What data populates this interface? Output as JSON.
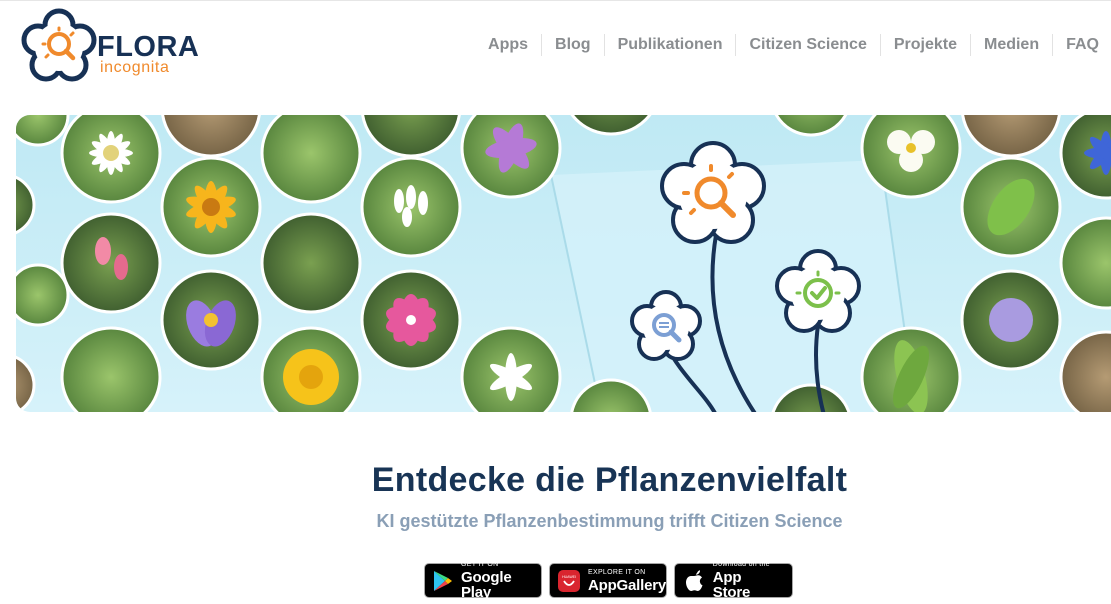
{
  "brand": {
    "name": "FLORA",
    "tagline": "incognita"
  },
  "nav": {
    "items": [
      {
        "id": "apps",
        "label": "Apps"
      },
      {
        "id": "blog",
        "label": "Blog"
      },
      {
        "id": "publikationen",
        "label": "Publikationen"
      },
      {
        "id": "citizen-science",
        "label": "Citizen Science"
      },
      {
        "id": "projekte",
        "label": "Projekte"
      },
      {
        "id": "medien",
        "label": "Medien"
      },
      {
        "id": "faq",
        "label": "FAQ"
      }
    ]
  },
  "hero": {
    "headline": "Entdecke die Pflanzenvielfalt",
    "subline": "KI gestützte Pflanzenbestimmung trifft Citizen Science"
  },
  "stores": {
    "google_play": {
      "small": "GET IT ON",
      "big": "Google Play",
      "icon": "google-play-icon"
    },
    "app_gallery": {
      "small": "EXPLORE IT ON",
      "big": "AppGallery",
      "icon": "huawei-icon"
    },
    "app_store": {
      "small": "Download on the",
      "big": "App Store",
      "icon": "apple-icon"
    }
  },
  "colors": {
    "navy": "#183455",
    "orange": "#f08a2c",
    "nav_text": "#8a8d90",
    "subline": "#8a9fb6",
    "hero_bg": "#c4ebf6",
    "accent_green": "#7cc04b"
  }
}
